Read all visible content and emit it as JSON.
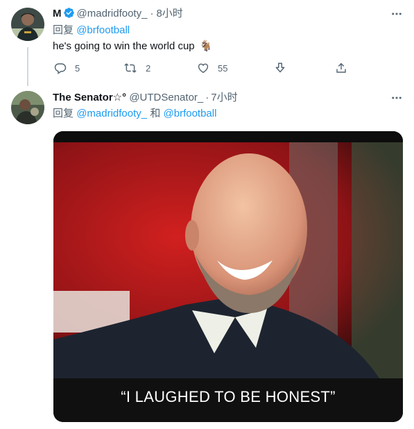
{
  "tweets": [
    {
      "display_name": "M",
      "handle": "@madridfooty_",
      "separator": "·",
      "time": "8小时",
      "reply_prefix": "回复",
      "reply_to_1": "@brfootball",
      "text": "he's going to win the world cup",
      "emoji": "🐐",
      "actions": {
        "replies": "5",
        "retweets": "2",
        "likes": "55"
      },
      "avatar_icon": "profile-photo",
      "verified_icon": "verified-badge-icon"
    },
    {
      "display_name": "The Senator☆°",
      "handle": "@UTDSenator_",
      "separator": "·",
      "time": "7小时",
      "reply_prefix": "回复",
      "reply_to_1": "@madridfooty_",
      "reply_joiner": "和",
      "reply_to_2": "@brfootball",
      "media": {
        "caption": "“I LAUGHED TO BE HONEST”"
      },
      "avatar_icon": "profile-photo"
    }
  ],
  "colors": {
    "link": "#1d9bf0",
    "muted": "#536471",
    "verified": "#1d9bf0",
    "thread_line": "#cfd9de"
  },
  "icons": [
    "more-icon",
    "reply-icon",
    "retweet-icon",
    "like-icon",
    "downvote-icon",
    "share-icon"
  ]
}
